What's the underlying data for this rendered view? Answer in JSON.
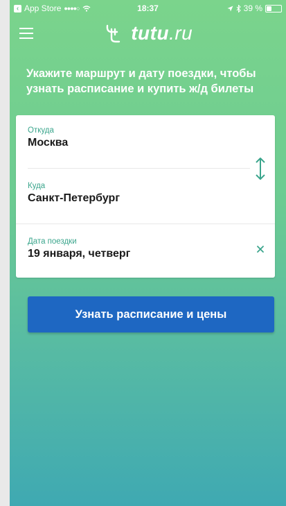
{
  "status_bar": {
    "back_label": "App Store",
    "signal": "●●●●○",
    "wifi": "ẛ",
    "time": "18:37",
    "location": "↗",
    "bluetooth": "✱",
    "battery_text": "39 %",
    "battery_level": 0.39
  },
  "header": {
    "logo_main": "tutu",
    "logo_tld": ".ru"
  },
  "headline": "Укажите маршрут и дату поездки, чтобы узнать расписание и купить ж/д билеты",
  "form": {
    "from": {
      "label": "Откуда",
      "value": "Москва"
    },
    "to": {
      "label": "Куда",
      "value": "Санкт-Петербург"
    },
    "date": {
      "label": "Дата поездки",
      "value": "19 января, четверг"
    }
  },
  "submit_label": "Узнать расписание и цены",
  "colors": {
    "accent": "#3aa58c",
    "button": "#1e67c2",
    "background_top": "#7bd48c",
    "background_bottom": "#3fa9b2"
  },
  "icons": {
    "menu": "hamburger-icon",
    "swap": "swap-arrows-icon",
    "clear": "close-icon",
    "logo": "tutu-logo-icon"
  }
}
